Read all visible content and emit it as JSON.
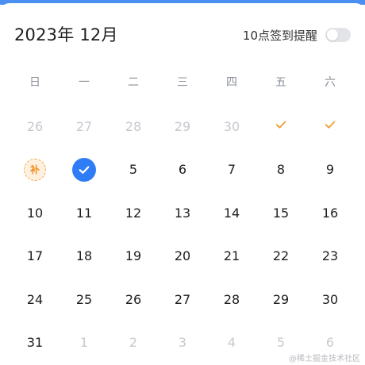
{
  "header": {
    "title": "2023年 12月",
    "reminder_label": "10点签到提醒",
    "reminder_enabled": false
  },
  "weekdays": [
    "日",
    "一",
    "二",
    "三",
    "四",
    "五",
    "六"
  ],
  "weeks": [
    [
      {
        "day": "26",
        "state": "muted"
      },
      {
        "day": "27",
        "state": "muted"
      },
      {
        "day": "28",
        "state": "muted"
      },
      {
        "day": "29",
        "state": "muted"
      },
      {
        "day": "30",
        "state": "muted"
      },
      {
        "day": "",
        "state": "checked"
      },
      {
        "day": "",
        "state": "checked"
      }
    ],
    [
      {
        "day": "",
        "state": "makeup",
        "badge": "补"
      },
      {
        "day": "",
        "state": "today-checked"
      },
      {
        "day": "5",
        "state": "normal"
      },
      {
        "day": "6",
        "state": "normal"
      },
      {
        "day": "7",
        "state": "normal"
      },
      {
        "day": "8",
        "state": "normal"
      },
      {
        "day": "9",
        "state": "normal"
      }
    ],
    [
      {
        "day": "10",
        "state": "normal"
      },
      {
        "day": "11",
        "state": "normal"
      },
      {
        "day": "12",
        "state": "normal"
      },
      {
        "day": "13",
        "state": "normal"
      },
      {
        "day": "14",
        "state": "normal"
      },
      {
        "day": "15",
        "state": "normal"
      },
      {
        "day": "16",
        "state": "normal"
      }
    ],
    [
      {
        "day": "17",
        "state": "normal"
      },
      {
        "day": "18",
        "state": "normal"
      },
      {
        "day": "19",
        "state": "normal"
      },
      {
        "day": "20",
        "state": "normal"
      },
      {
        "day": "21",
        "state": "normal"
      },
      {
        "day": "22",
        "state": "normal"
      },
      {
        "day": "23",
        "state": "normal"
      }
    ],
    [
      {
        "day": "24",
        "state": "normal"
      },
      {
        "day": "25",
        "state": "normal"
      },
      {
        "day": "26",
        "state": "normal"
      },
      {
        "day": "27",
        "state": "normal"
      },
      {
        "day": "28",
        "state": "normal"
      },
      {
        "day": "29",
        "state": "normal"
      },
      {
        "day": "30",
        "state": "normal"
      }
    ],
    [
      {
        "day": "31",
        "state": "normal"
      },
      {
        "day": "1",
        "state": "muted"
      },
      {
        "day": "2",
        "state": "muted"
      },
      {
        "day": "3",
        "state": "muted"
      },
      {
        "day": "4",
        "state": "muted"
      },
      {
        "day": "5",
        "state": "muted"
      },
      {
        "day": "6",
        "state": "muted"
      }
    ]
  ],
  "watermark": "@稀土掘金技术社区",
  "colors": {
    "accent_blue": "#2f7df6",
    "check_orange": "#f0a23b",
    "makeup_orange": "#f08c1a",
    "muted_text": "#c7c9cf",
    "top_strip": "#4a90f0"
  }
}
